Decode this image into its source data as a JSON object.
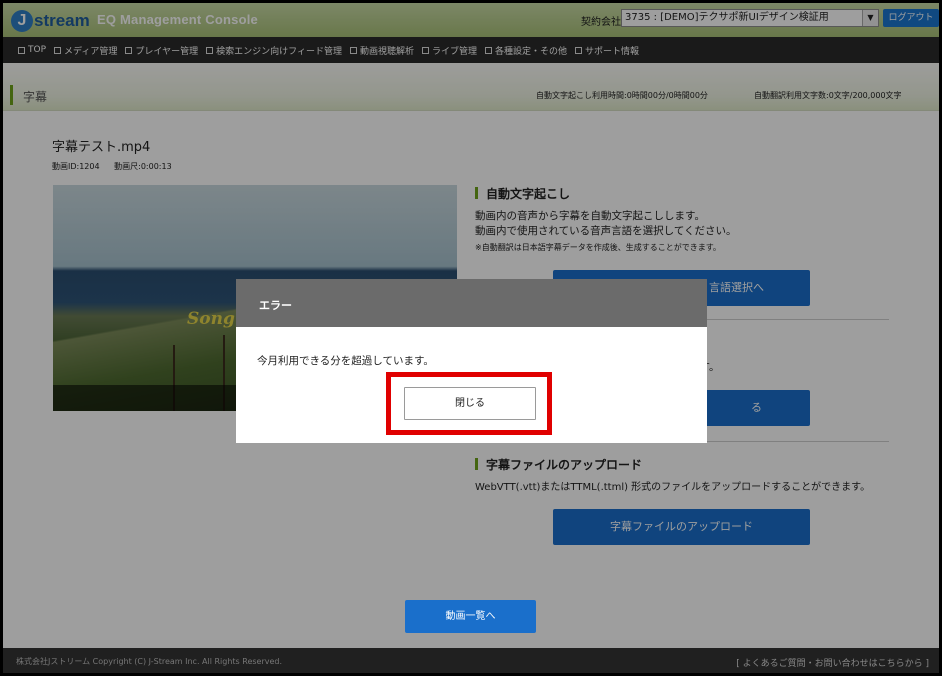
{
  "header": {
    "logo_letter": "J",
    "logo_text": "stream",
    "console_title": "EQ Management Console",
    "contract_label": "契約会社:",
    "contract_value": "3735 : [DEMO]テクサポ新UIデザイン検証用",
    "logout_label": "ログアウト"
  },
  "nav": {
    "items": [
      {
        "label": "TOP"
      },
      {
        "label": "メディア管理"
      },
      {
        "label": "プレイヤー管理"
      },
      {
        "label": "検索エンジン向けフィード管理"
      },
      {
        "label": "動画視聴解析"
      },
      {
        "label": "ライブ管理"
      },
      {
        "label": "各種設定・その他"
      },
      {
        "label": "サポート情報"
      }
    ]
  },
  "section": {
    "title": "字幕",
    "usage_transcription": "自動文字起こし利用時間:0時間00分/0時間00分",
    "usage_translation": "自動翻訳利用文字数:0文字/200,000文字"
  },
  "video": {
    "title": "字幕テスト.mp4",
    "id_label": "動画ID:1204",
    "duration_label": "動画尺:0:00:13",
    "overlay_text": "Song"
  },
  "auto_transcribe": {
    "heading": "自動文字起こし",
    "desc_line1": "動画内の音声から字幕を自動文字起こしします。",
    "desc_line2": "動画内で使用されている音声言語を選択してください。",
    "note": "※自動翻訳は日本語字幕データを作成後、生成することができます。",
    "button_label": "言語選択へ"
  },
  "second_section": {
    "desc_tail": "ます。",
    "button_label": "る"
  },
  "upload": {
    "heading": "字幕ファイルのアップロード",
    "desc": "WebVTT(.vtt)またはTTML(.ttml) 形式のファイルをアップロードすることができます。",
    "button_label": "字幕ファイルのアップロード"
  },
  "back_button_label": "動画一覧へ",
  "footer": {
    "copyright": "株式会社Jストリーム Copyright (C) J-Stream Inc. All Rights Reserved.",
    "faq_link": "[ よくあるご質問・お問い合わせはこちらから ]"
  },
  "modal": {
    "title": "エラー",
    "message": "今月利用できる分を超過しています。",
    "close_label": "閉じる"
  }
}
